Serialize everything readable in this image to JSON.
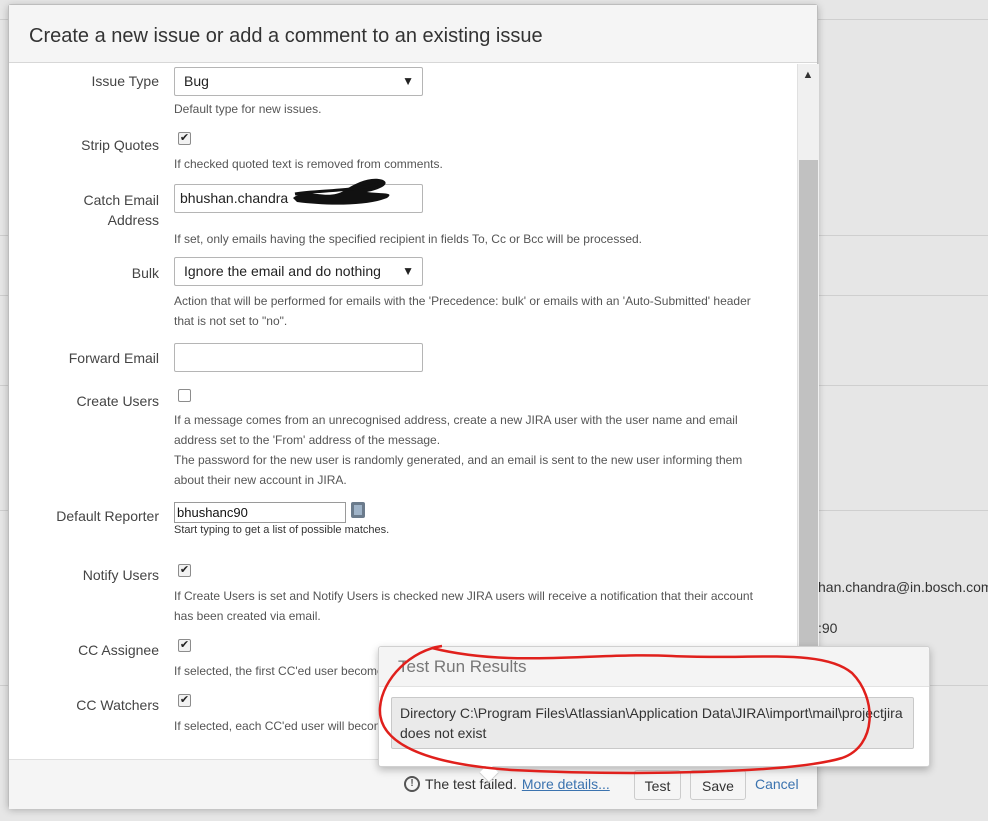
{
  "background": {
    "email_fragment": "han.chandra@in.bosch.com",
    "number_fragment": ":90"
  },
  "dialog": {
    "title": "Create a new issue or add a comment to an existing issue"
  },
  "form": {
    "issue_type": {
      "label": "Issue Type",
      "value": "Bug",
      "help": "Default type for new issues."
    },
    "strip_quotes": {
      "label": "Strip Quotes",
      "checked": true,
      "help": "If checked quoted text is removed from comments."
    },
    "catch_email": {
      "label_line1": "Catch Email",
      "label_line2": "Address",
      "value": "bhushan.chandra",
      "help": "If set, only emails having the specified recipient in fields To, Cc or Bcc will be processed."
    },
    "bulk": {
      "label": "Bulk",
      "value": "Ignore the email and do nothing",
      "help_line1": "Action that will be performed for emails with the 'Precedence: bulk' or emails with an 'Auto-Submitted' header",
      "help_line2": "that is not set to \"no\"."
    },
    "forward_email": {
      "label": "Forward Email",
      "value": ""
    },
    "create_users": {
      "label": "Create Users",
      "checked": false,
      "help_line1": "If a message comes from an unrecognised address, create a new JIRA user with the user name and email",
      "help_line2": "address set to the 'From' address of the message.",
      "help_line3": "The password for the new user is randomly generated, and an email is sent to the new user informing them",
      "help_line4": "about their new account in JIRA."
    },
    "default_reporter": {
      "label": "Default Reporter",
      "value": "bhushanc90",
      "help": "Start typing to get a list of possible matches."
    },
    "notify_users": {
      "label": "Notify Users",
      "checked": true,
      "help_line1": "If Create Users is set and Notify Users is checked new JIRA users will receive a notification that their account",
      "help_line2": "has been created via email."
    },
    "cc_assignee": {
      "label": "CC Assignee",
      "checked": true,
      "help": "If selected, the first CC'ed user become"
    },
    "cc_watchers": {
      "label": "CC Watchers",
      "checked": true,
      "help": "If selected, each CC'ed user will becon"
    }
  },
  "footer": {
    "status_text": "The test failed.",
    "details_link": "More details...",
    "test_button": "Test",
    "save_button": "Save",
    "cancel_link": "Cancel"
  },
  "test_results": {
    "title": "Test Run Results",
    "message_line1": "Directory C:\\Program Files\\Atlassian\\Application Data\\JIRA\\import\\mail\\projectjira",
    "message_line2": "does not exist"
  },
  "colors": {
    "link": "#3b73af",
    "annotation": "#e0201c",
    "redaction": "#111111"
  }
}
